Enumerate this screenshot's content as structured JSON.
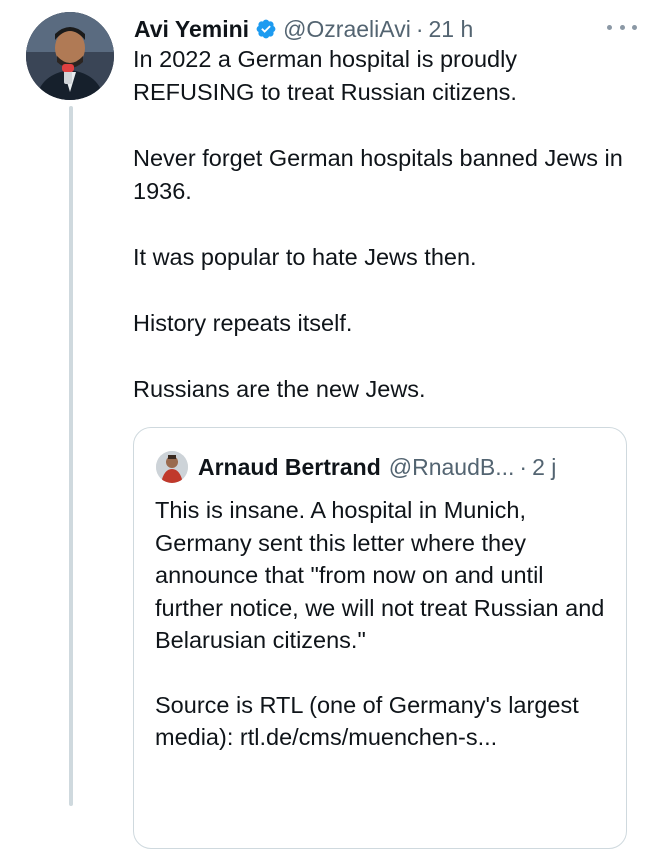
{
  "tweet": {
    "author_name": "Avi Yemini",
    "handle": "@OzraeliAvi",
    "separator": "·",
    "time": "21 h",
    "paragraphs": [
      "In 2022 a German hospital is proudly REFUSING to treat Russian citizens.",
      "Never forget German hospitals banned Jews in 1936.",
      "It was popular to hate Jews then.",
      "History repeats itself.",
      "Russians are the new Jews."
    ]
  },
  "quoted_tweet": {
    "author_name": "Arnaud Bertrand",
    "handle": "@RnaudB...",
    "separator": "·",
    "time": "2 j",
    "paragraphs": [
      "This is insane. A hospital in Munich, Germany sent this letter where they announce that \"from now on and until further notice, we will not treat Russian and Belarusian citizens.\"",
      "Source is RTL (one of Germany's largest media): rtl.de/cms/muenchen-s..."
    ]
  },
  "colors": {
    "verified_badge": "#1d9bf0",
    "secondary_text": "#536471",
    "border": "#cfd9de"
  },
  "icons": {
    "verified": "verified-badge-icon",
    "more": "more-options-icon"
  }
}
